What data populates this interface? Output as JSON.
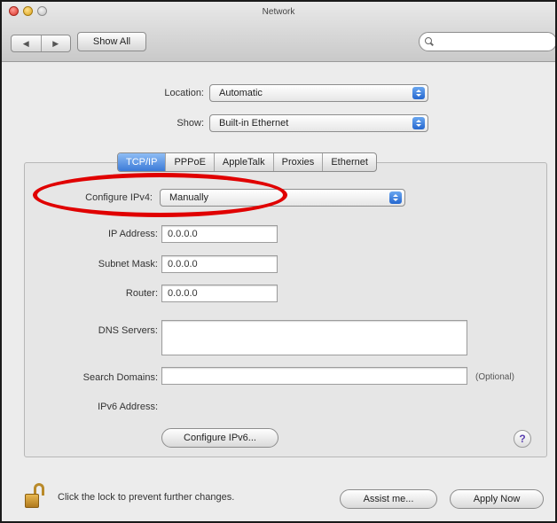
{
  "window": {
    "title": "Network"
  },
  "toolbar": {
    "back_glyph": "◀",
    "forward_glyph": "▶",
    "show_all_label": "Show All",
    "search_placeholder": "",
    "search_icon": "search-icon"
  },
  "location": {
    "label": "Location:",
    "value": "Automatic"
  },
  "show": {
    "label": "Show:",
    "value": "Built-in Ethernet"
  },
  "tabs": [
    "TCP/IP",
    "PPPoE",
    "AppleTalk",
    "Proxies",
    "Ethernet"
  ],
  "active_tab": "TCP/IP",
  "tcpip": {
    "configure_ipv4_label": "Configure IPv4:",
    "configure_ipv4_value": "Manually",
    "ip_address_label": "IP Address:",
    "ip_address_value": "0.0.0.0",
    "subnet_mask_label": "Subnet Mask:",
    "subnet_mask_value": "0.0.0.0",
    "router_label": "Router:",
    "router_value": "0.0.0.0",
    "dns_servers_label": "DNS Servers:",
    "dns_servers_value": "",
    "search_domains_label": "Search Domains:",
    "search_domains_value": "",
    "optional_label": "(Optional)",
    "ipv6_address_label": "IPv6 Address:",
    "configure_ipv6_label": "Configure IPv6...",
    "help_glyph": "?"
  },
  "footer": {
    "lock_text": "Click the lock to prevent further changes.",
    "assist_label": "Assist me...",
    "apply_label": "Apply Now"
  },
  "colors": {
    "highlight": "#e00000",
    "tab_active": "#3b7ad8",
    "popup_arrows": "#2567cf"
  }
}
